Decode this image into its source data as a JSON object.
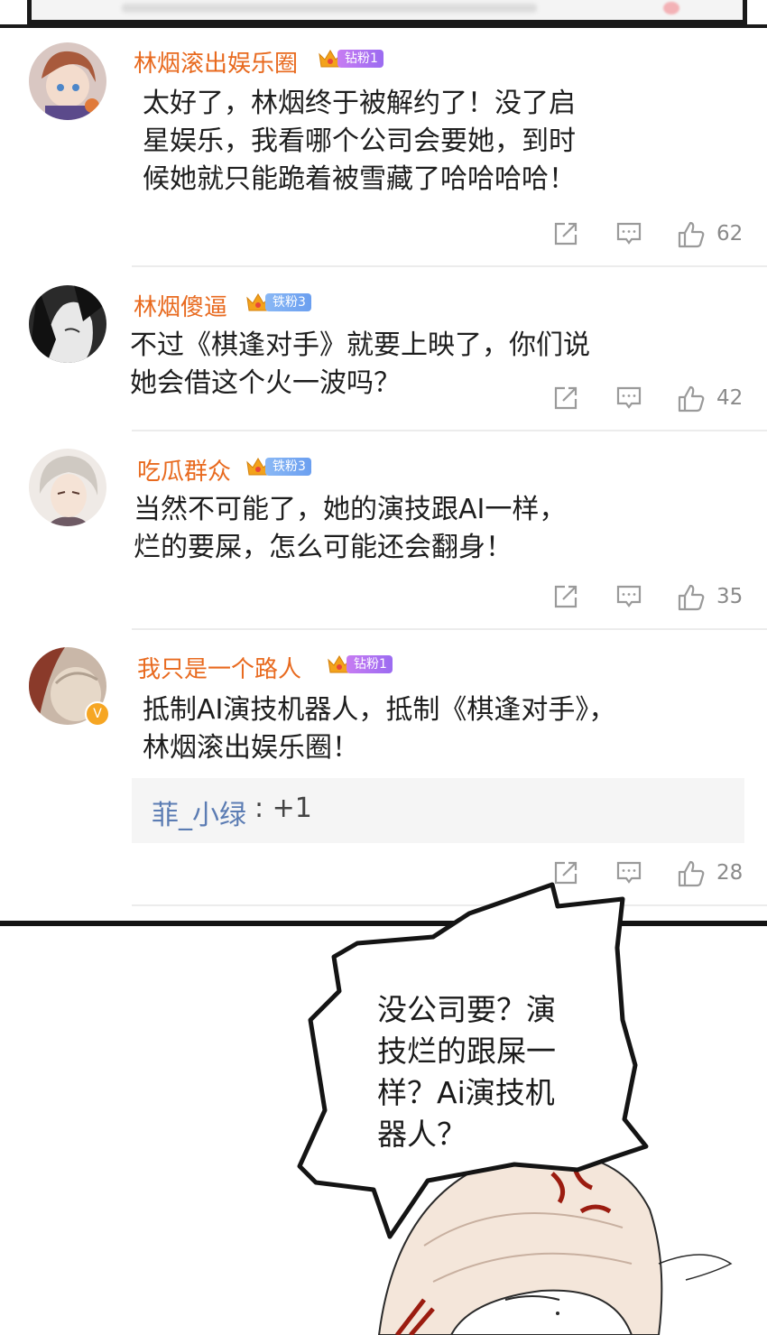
{
  "comments": [
    {
      "username": "林烟滚出娱乐圈",
      "badge": "钻粉1",
      "text_lines": [
        "太好了，林烟终于被解约了！没了启",
        "星娱乐，我看哪个公司会要她，到时",
        "候她就只能跪着被雪藏了哈哈哈哈！"
      ],
      "likes": "62"
    },
    {
      "username": "林烟傻逼",
      "badge": "铁粉3",
      "text_lines": [
        "不过《棋逢对手》就要上映了，你们说",
        "她会借这个火一波吗？"
      ],
      "likes": "42"
    },
    {
      "username": "吃瓜群众",
      "badge": "铁粉3",
      "text_lines": [
        "当然不可能了，她的演技跟AI一样，",
        "烂的要屎，怎么可能还会翻身！"
      ],
      "likes": "35"
    },
    {
      "username": "我只是一个路人",
      "badge": "钻粉1",
      "text_lines": [
        "抵制AI演技机器人，抵制《棋逢对手》，",
        "林烟滚出娱乐圈！"
      ],
      "likes": "28",
      "reply": {
        "name": "菲_小绿",
        "text": ": +1"
      },
      "vip_badge": "V"
    }
  ],
  "speech_bubble": {
    "lines": [
      "没公司要？演",
      "技烂的跟屎一",
      "样？Ai演技机",
      "器人？"
    ]
  },
  "colors": {
    "username": "#e86a1f",
    "reply_name": "#5b7cb3",
    "icon": "#9a9a9a",
    "badge_diamond": "#a873f2",
    "badge_iron": "#79a9f3"
  },
  "icons": [
    "share-icon",
    "comment-icon",
    "like-icon",
    "crown-icon"
  ]
}
